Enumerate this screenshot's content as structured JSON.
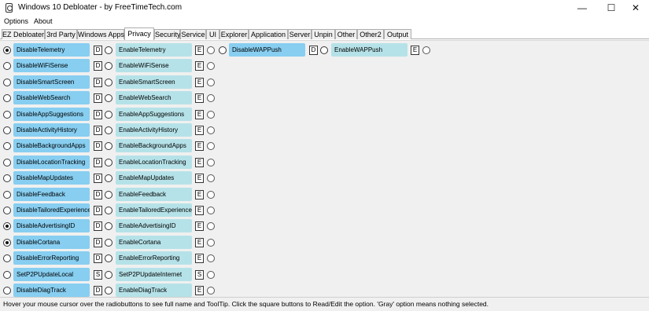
{
  "window": {
    "title": "Windows 10 Debloater - by FreeTimeTech.com",
    "minimize_glyph": "—",
    "maximize_glyph": "☐",
    "close_glyph": "✕"
  },
  "menu": [
    "Options",
    "About"
  ],
  "tabs": [
    "EZ Debloater",
    "3rd Party",
    "Windows Apps",
    "Privacy",
    "Security",
    "Service",
    "UI",
    "Explorer",
    "Application",
    "Server",
    "Unpin",
    "Other",
    "Other2",
    "Output"
  ],
  "active_tab": "Privacy",
  "colors": {
    "disable_button": "#87cef1",
    "enable_button": "#b5e2e8",
    "panel_bg": "#f0f0f0"
  },
  "options": [
    {
      "disable": "DisableTelemetry",
      "disable_key": "D",
      "enable": "EnableTelemetry",
      "enable_key": "E",
      "selected": "disable"
    },
    {
      "disable": "DisableWiFiSense",
      "disable_key": "D",
      "enable": "EnableWiFiSense",
      "enable_key": "E",
      "selected": "none"
    },
    {
      "disable": "DisableSmartScreen",
      "disable_key": "D",
      "enable": "EnableSmartScreen",
      "enable_key": "E",
      "selected": "none"
    },
    {
      "disable": "DisableWebSearch",
      "disable_key": "D",
      "enable": "EnableWebSearch",
      "enable_key": "E",
      "selected": "none"
    },
    {
      "disable": "DisableAppSuggestions",
      "disable_key": "D",
      "enable": "EnableAppSuggestions",
      "enable_key": "E",
      "selected": "none"
    },
    {
      "disable": "DisableActivityHistory",
      "disable_key": "D",
      "enable": "EnableActivityHistory",
      "enable_key": "E",
      "selected": "none"
    },
    {
      "disable": "DisableBackgroundApps",
      "disable_key": "D",
      "enable": "EnableBackgroundApps",
      "enable_key": "E",
      "selected": "none"
    },
    {
      "disable": "DisableLocationTracking",
      "disable_key": "D",
      "enable": "EnableLocationTracking",
      "enable_key": "E",
      "selected": "none"
    },
    {
      "disable": "DisableMapUpdates",
      "disable_key": "D",
      "enable": "EnableMapUpdates",
      "enable_key": "E",
      "selected": "none"
    },
    {
      "disable": "DisableFeedback",
      "disable_key": "D",
      "enable": "EnableFeedback",
      "enable_key": "E",
      "selected": "none"
    },
    {
      "disable": "DisableTailoredExperiences",
      "disable_key": "D",
      "enable": "EnableTailoredExperiences",
      "enable_key": "E",
      "selected": "none"
    },
    {
      "disable": "DisableAdvertisingID",
      "disable_key": "D",
      "enable": "EnableAdvertisingID",
      "enable_key": "E",
      "selected": "disable"
    },
    {
      "disable": "DisableCortana",
      "disable_key": "D",
      "enable": "EnableCortana",
      "enable_key": "E",
      "selected": "disable"
    },
    {
      "disable": "DisableErrorReporting",
      "disable_key": "D",
      "enable": "EnableErrorReporting",
      "enable_key": "E",
      "selected": "none"
    },
    {
      "disable": "SetP2PUpdateLocal",
      "disable_key": "S",
      "enable": "SetP2PUpdateInternet",
      "enable_key": "S",
      "selected": "none"
    },
    {
      "disable": "DisableDiagTrack",
      "disable_key": "D",
      "enable": "EnableDiagTrack",
      "enable_key": "E",
      "selected": "none"
    }
  ],
  "extra_option": {
    "disable": "DisableWAPPush",
    "disable_key": "D",
    "enable": "EnableWAPPush",
    "enable_key": "E",
    "selected": "none"
  },
  "status": "Hover your mouse cursor over the radiobuttons to see full name and ToolTip. Click the square buttons to Read/Edit the option. 'Gray' option means nothing selected."
}
